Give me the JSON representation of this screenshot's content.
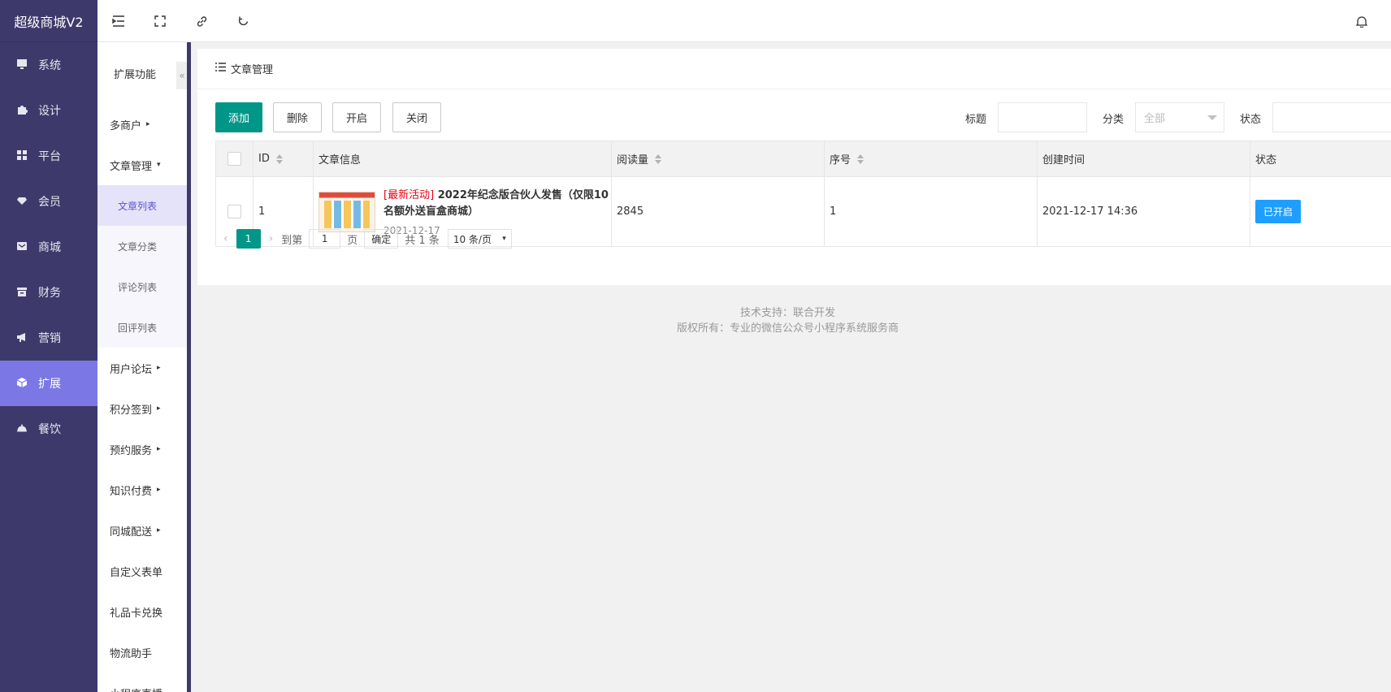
{
  "app": {
    "logo": "超级商城V2"
  },
  "nav1": [
    {
      "label": "系统",
      "icon": "monitor-icon"
    },
    {
      "label": "设计",
      "icon": "puzzle-icon"
    },
    {
      "label": "平台",
      "icon": "grid-icon"
    },
    {
      "label": "会员",
      "icon": "heart-icon"
    },
    {
      "label": "商城",
      "icon": "mail-icon"
    },
    {
      "label": "财务",
      "icon": "box-icon"
    },
    {
      "label": "营销",
      "icon": "megaphone-icon"
    },
    {
      "label": "扩展",
      "icon": "cube-icon",
      "active": true
    },
    {
      "label": "餐饮",
      "icon": "dish-icon"
    }
  ],
  "nav2": {
    "title": "扩展功能",
    "collapse": "«",
    "groups": [
      {
        "label": "多商户",
        "arrow": "▸"
      },
      {
        "label": "文章管理",
        "arrow": "▾"
      },
      {
        "label": "用户论坛",
        "arrow": "▸"
      },
      {
        "label": "积分签到",
        "arrow": "▸"
      },
      {
        "label": "预约服务",
        "arrow": "▸"
      },
      {
        "label": "知识付费",
        "arrow": "▸"
      },
      {
        "label": "同城配送",
        "arrow": "▸"
      },
      {
        "label": "自定义表单"
      },
      {
        "label": "礼品卡兑换"
      },
      {
        "label": "物流助手"
      },
      {
        "label": "小程序直播"
      }
    ],
    "sub": [
      {
        "label": "文章列表",
        "active": true
      },
      {
        "label": "文章分类"
      },
      {
        "label": "评论列表"
      },
      {
        "label": "回评列表"
      }
    ]
  },
  "topbar": {
    "icons": [
      "menu-fold-icon",
      "fullscreen-icon",
      "link-icon",
      "refresh-icon",
      "bell-icon"
    ]
  },
  "card": {
    "title": "文章管理"
  },
  "toolbar": {
    "add": "添加",
    "delete": "删除",
    "enable": "开启",
    "disable": "关闭",
    "title_label": "标题",
    "title_value": "",
    "category_label": "分类",
    "category_value": "全部",
    "status_label": "状态"
  },
  "table": {
    "headers": {
      "id": "ID",
      "info": "文章信息",
      "reads": "阅读量",
      "seq": "序号",
      "created": "创建时间",
      "status": "状态"
    },
    "rows": [
      {
        "id": "1",
        "tag": "[最新活动]",
        "title": "2022年纪念版合伙人发售（仅限10名额外送盲盒商城）",
        "date": "2021-12-17",
        "reads": "2845",
        "seq": "1",
        "created": "2021-12-17 14:36",
        "status": "已开启"
      }
    ]
  },
  "pager": {
    "current": "1",
    "goto": "到第",
    "page_input": "1",
    "page": "页",
    "confirm": "确定",
    "total": "共 1 条",
    "size": "10 条/页",
    "prev": "‹",
    "next": "›",
    "dd": "▾"
  },
  "footer": {
    "line1": "技术支持：联合开发",
    "line2": "版权所有：专业的微信公众号小程序系统服务商"
  }
}
